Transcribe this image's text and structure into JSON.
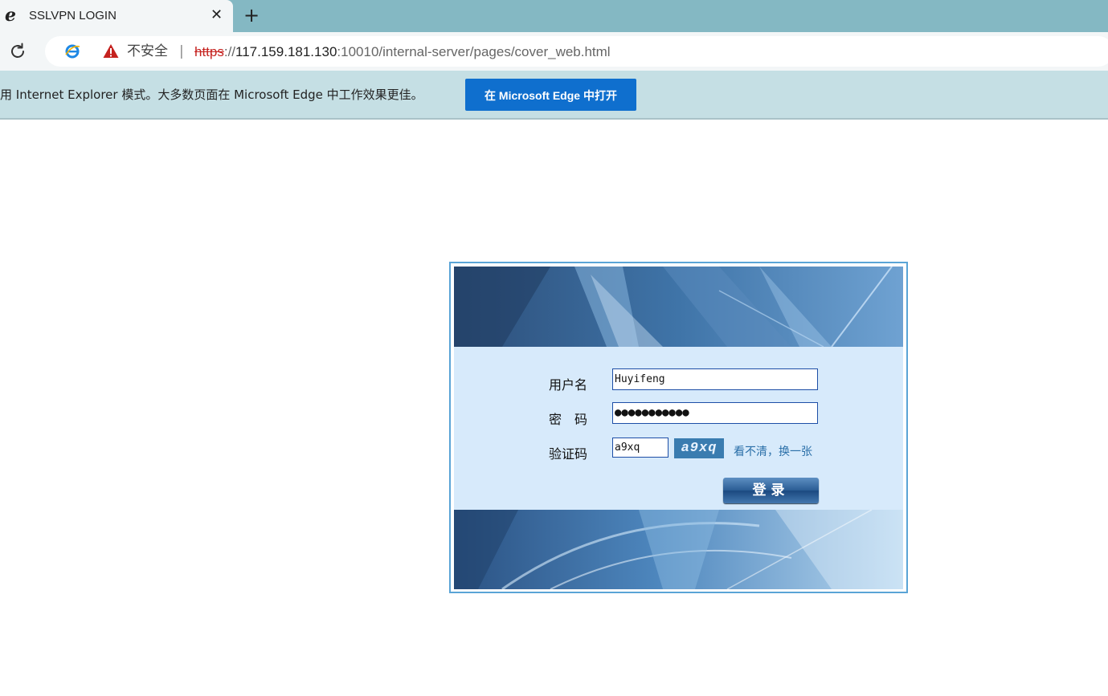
{
  "browser": {
    "tab_title": "SSLVPN LOGIN",
    "tab_close": "✕",
    "new_tab": "+",
    "insecure_label": "不安全",
    "separator": "|",
    "url_scheme": "https",
    "url_sep": "://",
    "url_host": "117.159.181.130",
    "url_rest": ":10010/internal-server/pages/cover_web.html"
  },
  "ie_bar": {
    "message": "用 Internet Explorer 模式。大多数页面在 Microsoft Edge 中工作效果更佳。",
    "button_label": "在 Microsoft Edge 中打开"
  },
  "login": {
    "username_label": "用户名",
    "username_value": "Huyifeng",
    "password_label": "密　码",
    "password_value": "●●●●●●●●●●●",
    "captcha_label": "验证码",
    "captcha_value": "a9xq",
    "captcha_image_text": "a9xq",
    "refresh_link": "看不清，换一张",
    "submit_label": "登录"
  },
  "colors": {
    "tabstrip": "#84b8c3",
    "ie_bar": "#c5dfe4",
    "edge_button": "#0f6fce",
    "form_bg": "#d7eafb",
    "frame_border": "#5aa4d6"
  }
}
